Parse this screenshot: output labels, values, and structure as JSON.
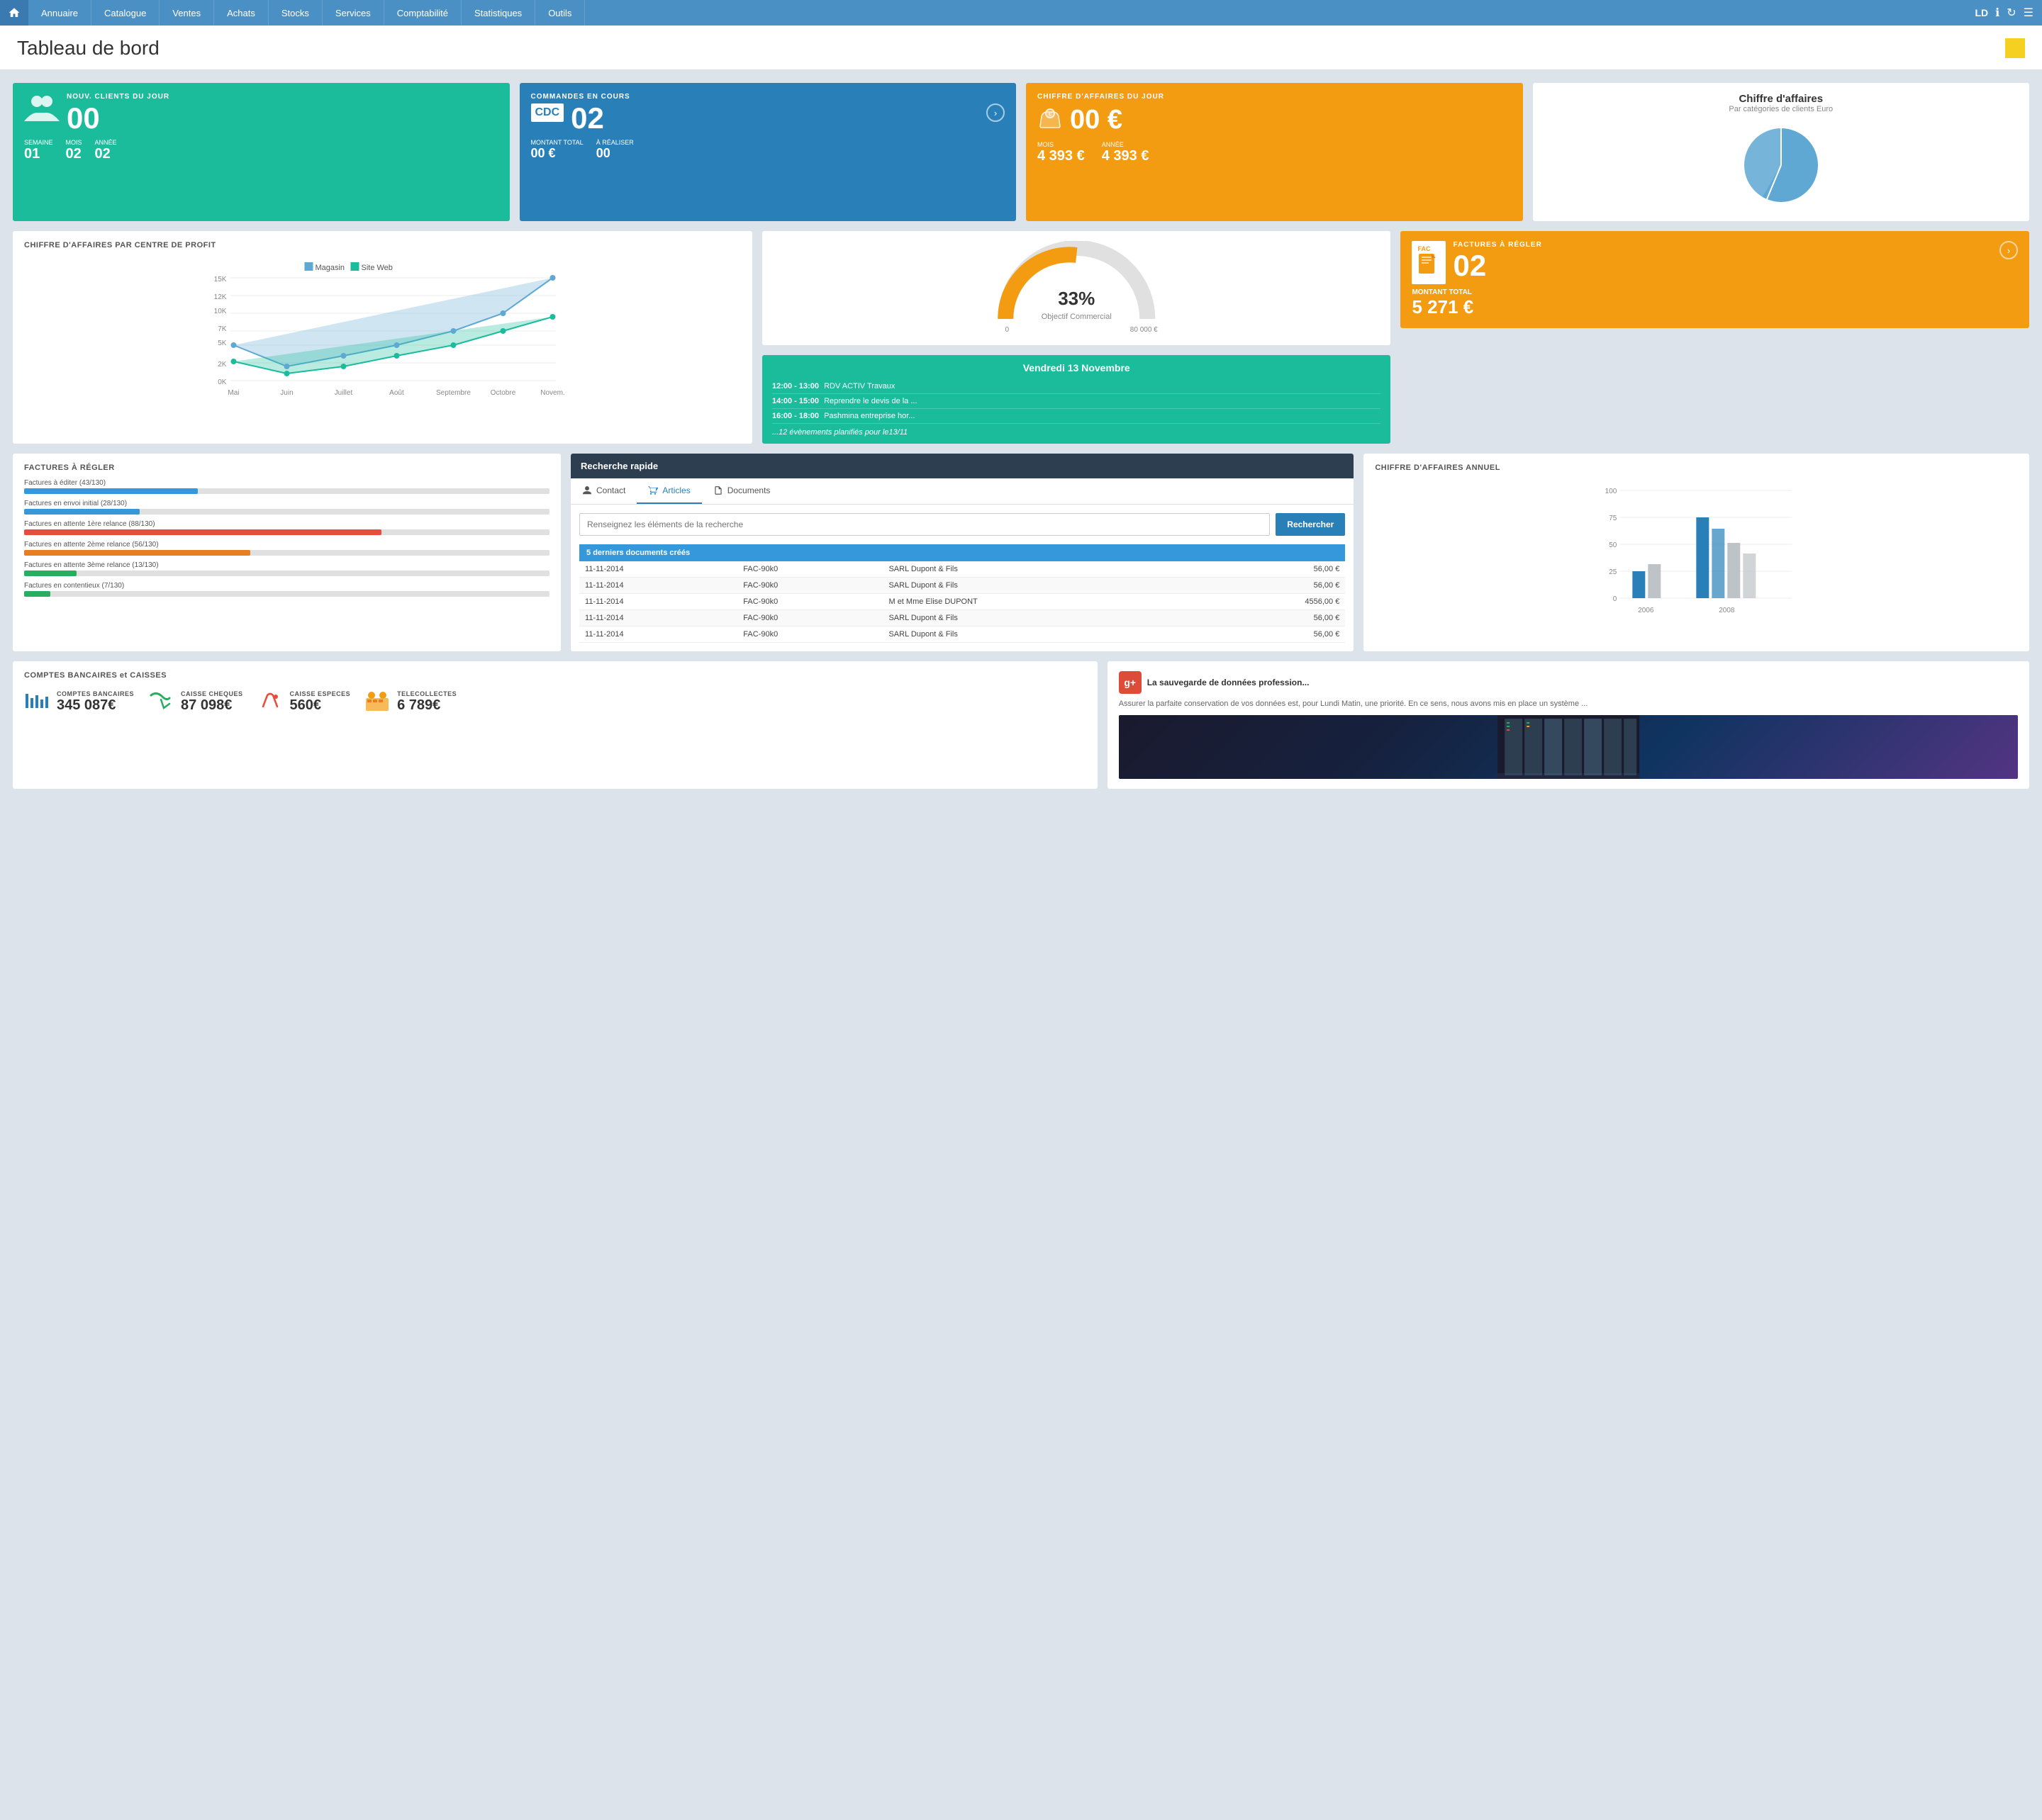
{
  "nav": {
    "items": [
      {
        "label": "Annuaire"
      },
      {
        "label": "Catalogue"
      },
      {
        "label": "Ventes"
      },
      {
        "label": "Achats"
      },
      {
        "label": "Stocks"
      },
      {
        "label": "Services"
      },
      {
        "label": "Comptabilité"
      },
      {
        "label": "Statistiques"
      },
      {
        "label": "Outils"
      }
    ],
    "user": "LD"
  },
  "page": {
    "title": "Tableau de bord"
  },
  "cards": {
    "nouveaux_clients": {
      "label": "NOUV. CLIENTS DU JOUR",
      "value": "00",
      "semaine_label": "SEMAINE",
      "semaine_val": "01",
      "mois_label": "MOIS",
      "mois_val": "02",
      "annee_label": "ANNÉE",
      "annee_val": "02"
    },
    "commandes": {
      "label": "COMMANDES EN COURS",
      "badge": "CDC",
      "value": "02",
      "montant_label": "MONTANT TOTAL",
      "montant_val": "00 €",
      "realiser_label": "À RÉALISER",
      "realiser_val": "00"
    },
    "chiffre_affaires": {
      "label": "CHIFFRE D'AFFAIRES DU JOUR",
      "value": "00 €",
      "mois_label": "MOIS",
      "mois_val": "4 393 €",
      "annee_label": "ANNÉE",
      "annee_val": "4 393 €"
    },
    "pie_chart": {
      "title": "Chiffre d'affaires",
      "subtitle": "Par catégories de clients Euro"
    }
  },
  "chart_profit": {
    "title": "CHIFFRE D'AFFAIRES PAR CENTRE DE PROFIT",
    "legend": [
      "Magasin",
      "Site Web"
    ],
    "y_labels": [
      "15K",
      "12K",
      "10K",
      "7K",
      "5K",
      "2K",
      "0K"
    ],
    "x_labels": [
      "Mai",
      "Juin",
      "Juillet",
      "Août",
      "Septembre",
      "Octobre",
      "Novem."
    ]
  },
  "gauge": {
    "percent": "33%",
    "label": "Objectif Commercial",
    "min": "0",
    "max": "80 000 €"
  },
  "calendar": {
    "date": "Vendredi 13 Novembre",
    "events": [
      {
        "time": "12:00 - 13:00",
        "desc": "RDV ACTIV Travaux"
      },
      {
        "time": "14:00 - 15:00",
        "desc": "Reprendre le devis de la ..."
      },
      {
        "time": "16:00 - 18:00",
        "desc": "Pashmina entreprise hor..."
      }
    ],
    "more": "...12 évènements planifiés pour le13/11"
  },
  "factures_orange": {
    "badge_label": "FAC",
    "title": "FACTURES À RÉGLER",
    "value": "02",
    "montant_label": "MONTANT TOTAL",
    "montant_val": "5 271 €"
  },
  "factures_regler": {
    "title": "FACTURES À RÉGLER",
    "items": [
      {
        "label": "Factures à éditer (43/130)",
        "pct": 33,
        "color": "#3498db"
      },
      {
        "label": "Factures en envoi initial (28/130)",
        "pct": 22,
        "color": "#3498db"
      },
      {
        "label": "Factures en attente 1ère relance (88/130)",
        "pct": 68,
        "color": "#e74c3c"
      },
      {
        "label": "Factures en attente 2ème relance (56/130)",
        "pct": 43,
        "color": "#e67e22"
      },
      {
        "label": "Factures en attente 3ème relance (13/130)",
        "pct": 10,
        "color": "#27ae60"
      },
      {
        "label": "Factures en contentieux (7/130)",
        "pct": 5,
        "color": "#27ae60"
      }
    ]
  },
  "recherche": {
    "header": "Recherche rapide",
    "tabs": [
      "Contact",
      "Articles",
      "Documents"
    ],
    "placeholder": "Renseignez les éléments de la recherche",
    "btn": "Rechercher",
    "docs_header": "5 derniers documents créés",
    "docs": [
      {
        "date": "11-11-2014",
        "ref": "FAC-90k0",
        "client": "SARL Dupont & Fils",
        "amount": "56,00 €"
      },
      {
        "date": "11-11-2014",
        "ref": "FAC-90k0",
        "client": "SARL Dupont & Fils",
        "amount": "56,00 €"
      },
      {
        "date": "11-11-2014",
        "ref": "FAC-90k0",
        "client": "M et Mme Elise DUPONT",
        "amount": "4556,00 €"
      },
      {
        "date": "11-11-2014",
        "ref": "FAC-90k0",
        "client": "SARL Dupont & Fils",
        "amount": "56,00 €"
      },
      {
        "date": "11-11-2014",
        "ref": "FAC-90k0",
        "client": "SARL Dupont & Fils",
        "amount": "56,00 €"
      }
    ]
  },
  "annual_chart": {
    "title": "CHIFFRE D'AFFAIRES ANNUEL",
    "y_labels": [
      "100",
      "75",
      "50",
      "25",
      "0"
    ],
    "x_labels": [
      "2006",
      "2008"
    ],
    "bars": [
      {
        "year": "2006",
        "vals": [
          22,
          30
        ]
      },
      {
        "year": "2008",
        "vals": [
          72,
          60,
          48,
          42
        ]
      }
    ]
  },
  "comptes": {
    "title": "COMPTES BANCAIRES et CAISSES",
    "items": [
      {
        "label": "COMPTES BANCAIRES",
        "value": "345 087€"
      },
      {
        "label": "CAISSE CHEQUES",
        "value": "87 098€"
      },
      {
        "label": "CAISSE ESPECES",
        "value": "560€"
      },
      {
        "label": "TELECOLLECTES",
        "value": "6 789€"
      }
    ]
  },
  "gplus": {
    "title": "La sauvegarde de données profession...",
    "text": "Assurer la parfaite conservation de vos données est, pour Lundi Matin, une priorité. En ce sens, nous avons mis en place un système ..."
  }
}
